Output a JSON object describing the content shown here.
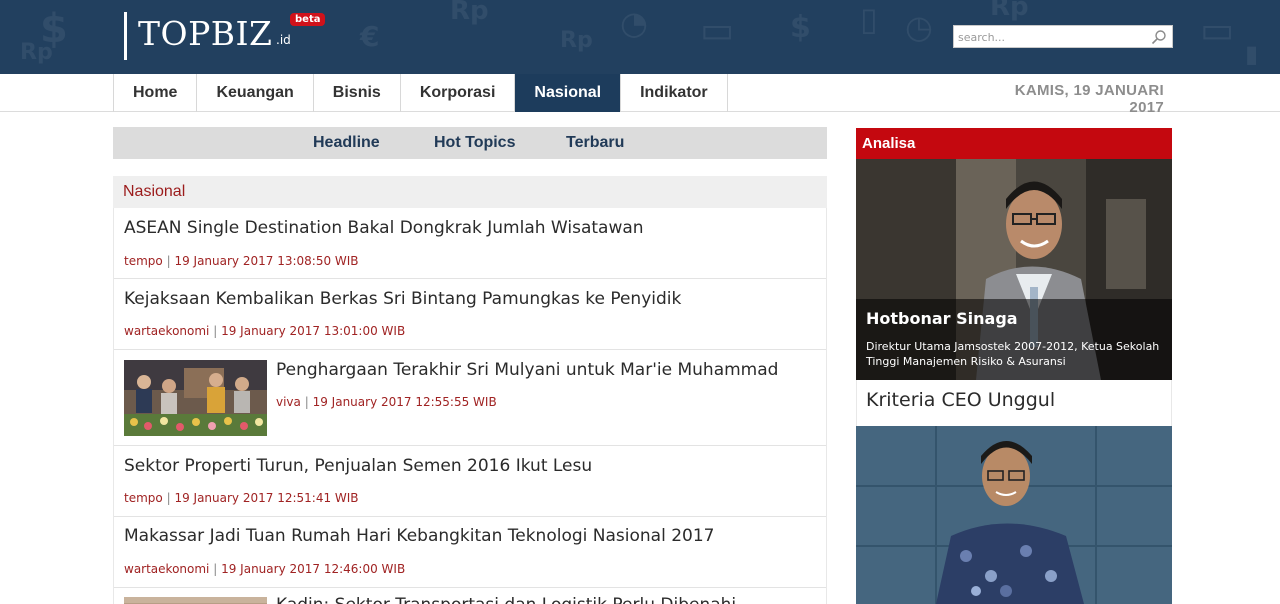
{
  "header": {
    "logo_text": "TOPBIZ",
    "logo_suffix": ".id",
    "beta_badge": "beta",
    "search_placeholder": "search..."
  },
  "nav": {
    "items": [
      {
        "label": "Home"
      },
      {
        "label": "Keuangan"
      },
      {
        "label": "Bisnis"
      },
      {
        "label": "Korporasi"
      },
      {
        "label": "Nasional",
        "active": true
      },
      {
        "label": "Indikator"
      }
    ],
    "date": "KAMIS, 19 JANUARI 2017"
  },
  "subnav": {
    "items": [
      {
        "label": "Headline"
      },
      {
        "label": "Hot Topics"
      },
      {
        "label": "Terbaru"
      }
    ]
  },
  "section": {
    "title": "Nasional",
    "items": [
      {
        "title": "ASEAN Single Destination Bakal Dongkrak Jumlah Wisatawan",
        "source": "tempo",
        "separator": "|",
        "datetime": "19 January 2017 13:08:50 WIB"
      },
      {
        "title": "Kejaksaan Kembalikan Berkas Sri Bintang Pamungkas ke Penyidik",
        "source": "wartaekonomi",
        "separator": "|",
        "datetime": "19 January 2017 13:01:00 WIB"
      },
      {
        "title": "Penghargaan Terakhir Sri Mulyani untuk Mar'ie Muhammad",
        "source": "viva",
        "separator": "|",
        "datetime": "19 January 2017 12:55:55 WIB"
      },
      {
        "title": "Sektor Properti Turun, Penjualan Semen 2016 Ikut Lesu",
        "source": "tempo",
        "separator": "|",
        "datetime": "19 January 2017 12:51:41 WIB"
      },
      {
        "title": "Makassar Jadi Tuan Rumah Hari Kebangkitan Teknologi Nasional 2017",
        "source": "wartaekonomi",
        "separator": "|",
        "datetime": "19 January 2017 12:46:00 WIB"
      },
      {
        "title": "Kadin: Sektor Transportasi dan Logistik Perlu Dibenahi",
        "source": "",
        "separator": "",
        "datetime": ""
      }
    ]
  },
  "sidebar": {
    "heading": "Analisa",
    "author_name": "Hotbonar Sinaga",
    "author_role": "Direktur Utama Jamsostek 2007-2012, Ketua Sekolah Tinggi Manajemen Risiko & Asuransi",
    "article_title": "Kriteria CEO Unggul"
  },
  "colors": {
    "header_bg": "#22405f",
    "nav_active": "#1d3c5c",
    "accent_red": "#c4080f",
    "meta_red": "#a02323"
  }
}
